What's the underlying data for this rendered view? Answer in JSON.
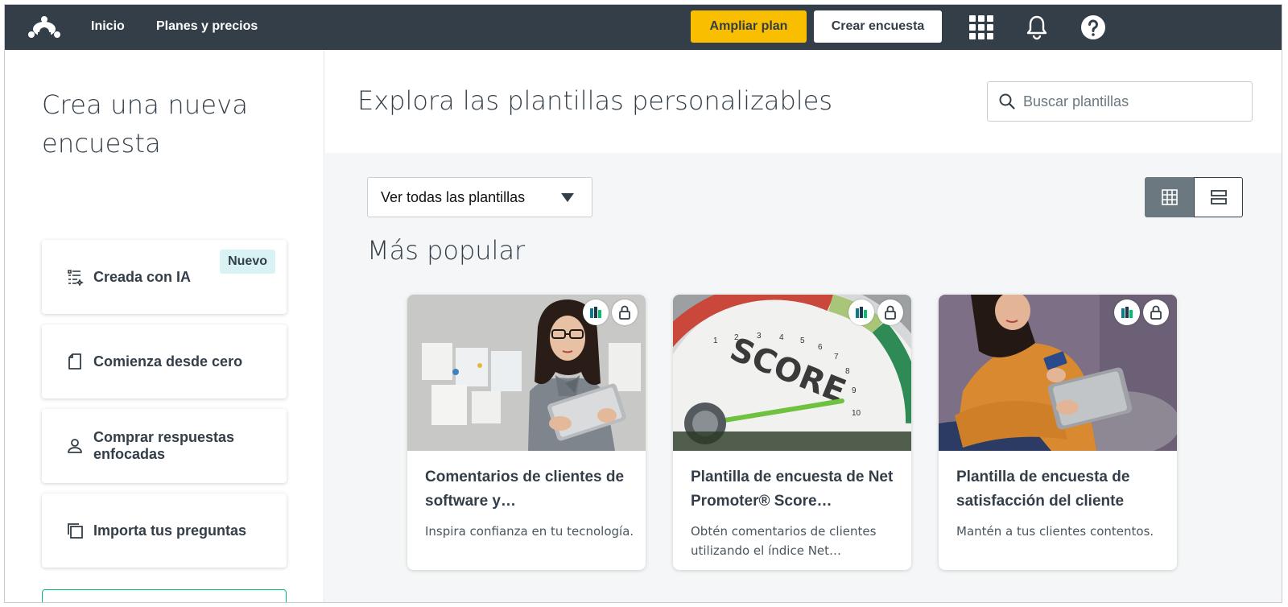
{
  "nav": {
    "links": [
      "Inicio",
      "Planes y precios"
    ],
    "upgrade_label": "Ampliar plan",
    "create_label": "Crear encuesta",
    "icons": [
      "apps-grid-icon",
      "bell-icon",
      "help-icon"
    ]
  },
  "left": {
    "title": "Crea una nueva encuesta",
    "cards": [
      {
        "label": "Creada con IA",
        "icon": "ai-list-icon",
        "badge": "Nuevo"
      },
      {
        "label": "Comienza desde cero",
        "icon": "blank-page-icon"
      },
      {
        "label": "Comprar respuestas enfocadas",
        "icon": "person-icon"
      },
      {
        "label": "Importa tus preguntas",
        "icon": "copy-icon"
      }
    ]
  },
  "main": {
    "title": "Explora las plantillas personalizables",
    "search": {
      "placeholder": "Buscar plantillas",
      "value": ""
    },
    "filter": {
      "selected": "Ver todas las plantillas"
    },
    "section_title": "Más popular",
    "templates": [
      {
        "title": "Comentarios de clientes de software y…",
        "desc": "Inspira confianza en tu tecnología."
      },
      {
        "title": "Plantilla de encuesta de Net Promoter® Score…",
        "desc": "Obtén comentarios de clientes utilizando el índice Net…"
      },
      {
        "title": "Plantilla de encuesta de satisfacción del cliente",
        "desc": "Mantén a tus clientes contentos."
      }
    ]
  },
  "colors": {
    "nav_bg": "#333e48",
    "upgrade_bg": "#f9be00",
    "content_bg": "#f4f6f7",
    "badge_bg": "#d9f3f5",
    "accent_green": "#00bf6f"
  }
}
